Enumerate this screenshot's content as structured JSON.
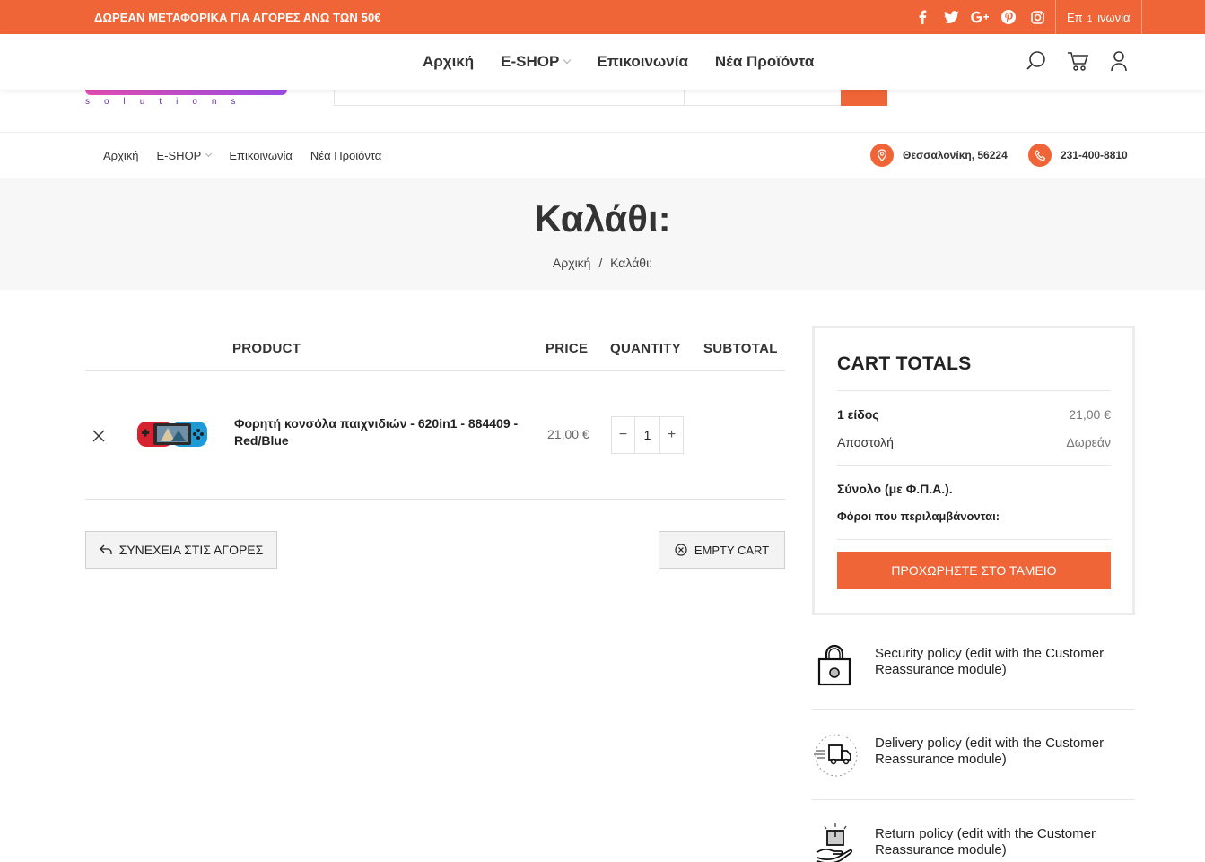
{
  "topbar": {
    "promo": "ΔΩΡΕΑΝ ΜΕΤΑΦΟΡΙΚΑ ΓΙΑ ΑΓΟΡΕΣ ΑΝΩ ΤΩΝ 50€",
    "contact": "Επικοινωνία"
  },
  "nav": {
    "home": "Αρχική",
    "shop": "E-SHOP",
    "contact": "Επικοινωνία",
    "new": "Νέα Προϊόντα",
    "cart_count": "1"
  },
  "logo": {
    "tagline": "solutions"
  },
  "secnav": {
    "home": "Αρχική",
    "shop": "E-SHOP",
    "contact": "Επικοινωνία",
    "new": "Νέα Προϊόντα",
    "location": "Θεσσαλονίκη, 56224",
    "phone": "231-400-8810"
  },
  "page": {
    "title": "Καλάθι:",
    "breadcrumb_home": "Αρχική",
    "breadcrumb_sep": "/",
    "breadcrumb_current": "Καλάθι:"
  },
  "cart": {
    "headers": {
      "product": "PRODUCT",
      "price": "PRICE",
      "quantity": "QUANTITY",
      "subtotal": "SUBTOTAL"
    },
    "items": [
      {
        "name": "Φορητή κονσόλα παιχνιδιών - 620in1 - 884409 - Red/Blue",
        "price": "21,00 €",
        "quantity": "1"
      }
    ],
    "continue_label": "ΣΥΝΕΧΕΙΑ ΣΤΙΣ ΑΓΟΡΕΣ",
    "empty_label": "EMPTY CART"
  },
  "totals": {
    "title": "CART TOTALS",
    "items_label": "1 είδος",
    "items_value": "21,00 €",
    "shipping_label": "Αποστολή",
    "shipping_value": "Δωρεάν",
    "total_label": "Σύνολο (με Φ.Π.Α.).",
    "tax_label": "Φόροι που περιλαμβάνονται:",
    "checkout_label": "ΠΡΟΧΩΡΗΣΤΕ ΣΤΟ ΤΑΜΕΙΟ"
  },
  "reassurance": [
    {
      "icon": "lock-icon",
      "text": "Security policy (edit with the Customer Reassurance module)"
    },
    {
      "icon": "delivery-truck-icon",
      "text": "Delivery policy (edit with the Customer Reassurance module)"
    },
    {
      "icon": "return-box-icon",
      "text": "Return policy (edit with the Customer Reassurance module)"
    }
  ],
  "colors": {
    "accent": "#ef6537"
  }
}
